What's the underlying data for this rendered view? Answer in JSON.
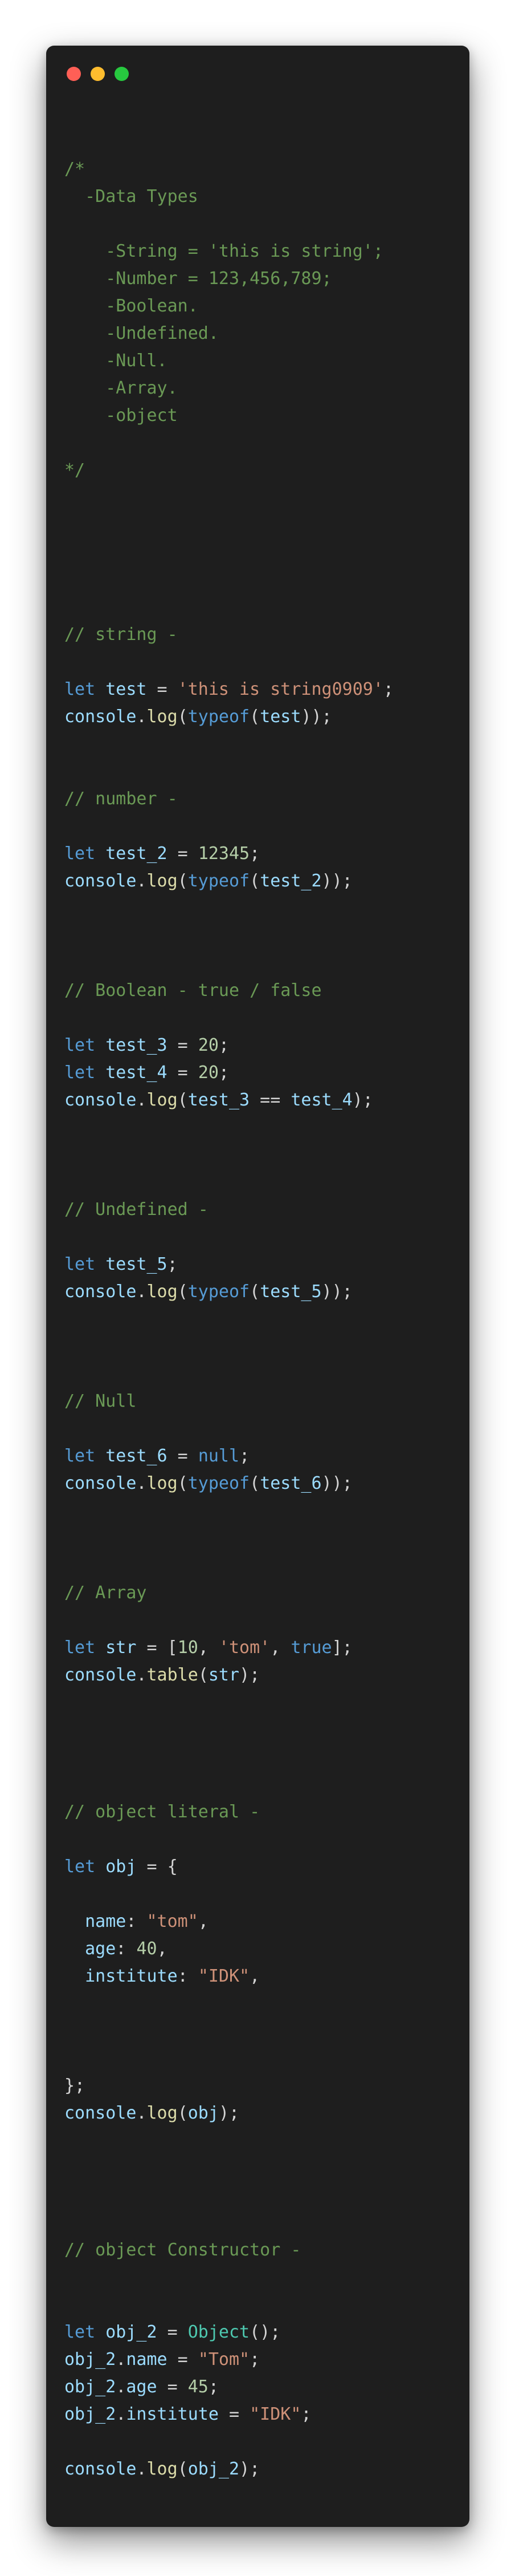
{
  "window": {
    "controls": [
      {
        "name": "close",
        "color": "#ff5f56"
      },
      {
        "name": "minimize",
        "color": "#ffbd2e"
      },
      {
        "name": "maximize",
        "color": "#27c93f"
      }
    ]
  },
  "colors": {
    "background": "#1e1e1e",
    "comment": "#6a9955",
    "keyword": "#569cd6",
    "variable": "#9cdcfe",
    "function": "#dcdcaa",
    "string": "#ce9178",
    "number": "#b5cea8",
    "class": "#4ec9b0",
    "plain": "#d4d4d4"
  },
  "code": {
    "lines": [
      [
        {
          "t": "comment",
          "v": "/*"
        }
      ],
      [
        {
          "t": "comment",
          "v": "  -Data Types"
        }
      ],
      [],
      [
        {
          "t": "comment",
          "v": "    -String = 'this is string';"
        }
      ],
      [
        {
          "t": "comment",
          "v": "    -Number = 123,456,789;"
        }
      ],
      [
        {
          "t": "comment",
          "v": "    -Boolean."
        }
      ],
      [
        {
          "t": "comment",
          "v": "    -Undefined."
        }
      ],
      [
        {
          "t": "comment",
          "v": "    -Null."
        }
      ],
      [
        {
          "t": "comment",
          "v": "    -Array."
        }
      ],
      [
        {
          "t": "comment",
          "v": "    -object"
        }
      ],
      [],
      [
        {
          "t": "comment",
          "v": "*/"
        }
      ],
      [],
      [],
      [],
      [],
      [],
      [
        {
          "t": "comment",
          "v": "// string -"
        }
      ],
      [],
      [
        {
          "t": "keyword",
          "v": "let"
        },
        {
          "t": "plain",
          "v": " "
        },
        {
          "t": "var",
          "v": "test"
        },
        {
          "t": "plain",
          "v": " = "
        },
        {
          "t": "string",
          "v": "'this is string0909'"
        },
        {
          "t": "plain",
          "v": ";"
        }
      ],
      [
        {
          "t": "var",
          "v": "console"
        },
        {
          "t": "plain",
          "v": "."
        },
        {
          "t": "fn",
          "v": "log"
        },
        {
          "t": "plain",
          "v": "("
        },
        {
          "t": "keyword",
          "v": "typeof"
        },
        {
          "t": "plain",
          "v": "("
        },
        {
          "t": "var",
          "v": "test"
        },
        {
          "t": "plain",
          "v": "));"
        }
      ],
      [],
      [],
      [
        {
          "t": "comment",
          "v": "// number -"
        }
      ],
      [],
      [
        {
          "t": "keyword",
          "v": "let"
        },
        {
          "t": "plain",
          "v": " "
        },
        {
          "t": "var",
          "v": "test_2"
        },
        {
          "t": "plain",
          "v": " = "
        },
        {
          "t": "number",
          "v": "12345"
        },
        {
          "t": "plain",
          "v": ";"
        }
      ],
      [
        {
          "t": "var",
          "v": "console"
        },
        {
          "t": "plain",
          "v": "."
        },
        {
          "t": "fn",
          "v": "log"
        },
        {
          "t": "plain",
          "v": "("
        },
        {
          "t": "keyword",
          "v": "typeof"
        },
        {
          "t": "plain",
          "v": "("
        },
        {
          "t": "var",
          "v": "test_2"
        },
        {
          "t": "plain",
          "v": "));"
        }
      ],
      [],
      [],
      [],
      [
        {
          "t": "comment",
          "v": "// Boolean - true / false"
        }
      ],
      [],
      [
        {
          "t": "keyword",
          "v": "let"
        },
        {
          "t": "plain",
          "v": " "
        },
        {
          "t": "var",
          "v": "test_3"
        },
        {
          "t": "plain",
          "v": " = "
        },
        {
          "t": "number",
          "v": "20"
        },
        {
          "t": "plain",
          "v": ";"
        }
      ],
      [
        {
          "t": "keyword",
          "v": "let"
        },
        {
          "t": "plain",
          "v": " "
        },
        {
          "t": "var",
          "v": "test_4"
        },
        {
          "t": "plain",
          "v": " = "
        },
        {
          "t": "number",
          "v": "20"
        },
        {
          "t": "plain",
          "v": ";"
        }
      ],
      [
        {
          "t": "var",
          "v": "console"
        },
        {
          "t": "plain",
          "v": "."
        },
        {
          "t": "fn",
          "v": "log"
        },
        {
          "t": "plain",
          "v": "("
        },
        {
          "t": "var",
          "v": "test_3"
        },
        {
          "t": "plain",
          "v": " == "
        },
        {
          "t": "var",
          "v": "test_4"
        },
        {
          "t": "plain",
          "v": ");"
        }
      ],
      [],
      [],
      [],
      [
        {
          "t": "comment",
          "v": "// Undefined -"
        }
      ],
      [],
      [
        {
          "t": "keyword",
          "v": "let"
        },
        {
          "t": "plain",
          "v": " "
        },
        {
          "t": "var",
          "v": "test_5"
        },
        {
          "t": "plain",
          "v": ";"
        }
      ],
      [
        {
          "t": "var",
          "v": "console"
        },
        {
          "t": "plain",
          "v": "."
        },
        {
          "t": "fn",
          "v": "log"
        },
        {
          "t": "plain",
          "v": "("
        },
        {
          "t": "keyword",
          "v": "typeof"
        },
        {
          "t": "plain",
          "v": "("
        },
        {
          "t": "var",
          "v": "test_5"
        },
        {
          "t": "plain",
          "v": "));"
        }
      ],
      [],
      [],
      [],
      [
        {
          "t": "comment",
          "v": "// Null"
        }
      ],
      [],
      [
        {
          "t": "keyword",
          "v": "let"
        },
        {
          "t": "plain",
          "v": " "
        },
        {
          "t": "var",
          "v": "test_6"
        },
        {
          "t": "plain",
          "v": " = "
        },
        {
          "t": "keyword",
          "v": "null"
        },
        {
          "t": "plain",
          "v": ";"
        }
      ],
      [
        {
          "t": "var",
          "v": "console"
        },
        {
          "t": "plain",
          "v": "."
        },
        {
          "t": "fn",
          "v": "log"
        },
        {
          "t": "plain",
          "v": "("
        },
        {
          "t": "keyword",
          "v": "typeof"
        },
        {
          "t": "plain",
          "v": "("
        },
        {
          "t": "var",
          "v": "test_6"
        },
        {
          "t": "plain",
          "v": "));"
        }
      ],
      [],
      [],
      [],
      [
        {
          "t": "comment",
          "v": "// Array"
        }
      ],
      [],
      [
        {
          "t": "keyword",
          "v": "let"
        },
        {
          "t": "plain",
          "v": " "
        },
        {
          "t": "var",
          "v": "str"
        },
        {
          "t": "plain",
          "v": " = ["
        },
        {
          "t": "number",
          "v": "10"
        },
        {
          "t": "plain",
          "v": ", "
        },
        {
          "t": "string",
          "v": "'tom'"
        },
        {
          "t": "plain",
          "v": ", "
        },
        {
          "t": "keyword",
          "v": "true"
        },
        {
          "t": "plain",
          "v": "];"
        }
      ],
      [
        {
          "t": "var",
          "v": "console"
        },
        {
          "t": "plain",
          "v": "."
        },
        {
          "t": "fn",
          "v": "table"
        },
        {
          "t": "plain",
          "v": "("
        },
        {
          "t": "var",
          "v": "str"
        },
        {
          "t": "plain",
          "v": ");"
        }
      ],
      [],
      [],
      [],
      [],
      [
        {
          "t": "comment",
          "v": "// object literal -"
        }
      ],
      [],
      [
        {
          "t": "keyword",
          "v": "let"
        },
        {
          "t": "plain",
          "v": " "
        },
        {
          "t": "var",
          "v": "obj"
        },
        {
          "t": "plain",
          "v": " = {"
        }
      ],
      [],
      [
        {
          "t": "plain",
          "v": "  "
        },
        {
          "t": "var",
          "v": "name"
        },
        {
          "t": "plain",
          "v": ": "
        },
        {
          "t": "string",
          "v": "\"tom\""
        },
        {
          "t": "plain",
          "v": ","
        }
      ],
      [
        {
          "t": "plain",
          "v": "  "
        },
        {
          "t": "var",
          "v": "age"
        },
        {
          "t": "plain",
          "v": ": "
        },
        {
          "t": "number",
          "v": "40"
        },
        {
          "t": "plain",
          "v": ","
        }
      ],
      [
        {
          "t": "plain",
          "v": "  "
        },
        {
          "t": "var",
          "v": "institute"
        },
        {
          "t": "plain",
          "v": ": "
        },
        {
          "t": "string",
          "v": "\"IDK\""
        },
        {
          "t": "plain",
          "v": ","
        }
      ],
      [],
      [],
      [],
      [
        {
          "t": "plain",
          "v": "};"
        }
      ],
      [
        {
          "t": "var",
          "v": "console"
        },
        {
          "t": "plain",
          "v": "."
        },
        {
          "t": "fn",
          "v": "log"
        },
        {
          "t": "plain",
          "v": "("
        },
        {
          "t": "var",
          "v": "obj"
        },
        {
          "t": "plain",
          "v": ");"
        }
      ],
      [],
      [],
      [],
      [],
      [
        {
          "t": "comment",
          "v": "// object Constructor -"
        }
      ],
      [],
      [],
      [
        {
          "t": "keyword",
          "v": "let"
        },
        {
          "t": "plain",
          "v": " "
        },
        {
          "t": "var",
          "v": "obj_2"
        },
        {
          "t": "plain",
          "v": " = "
        },
        {
          "t": "class",
          "v": "Object"
        },
        {
          "t": "plain",
          "v": "();"
        }
      ],
      [
        {
          "t": "var",
          "v": "obj_2"
        },
        {
          "t": "plain",
          "v": "."
        },
        {
          "t": "var",
          "v": "name"
        },
        {
          "t": "plain",
          "v": " = "
        },
        {
          "t": "string",
          "v": "\"Tom\""
        },
        {
          "t": "plain",
          "v": ";"
        }
      ],
      [
        {
          "t": "var",
          "v": "obj_2"
        },
        {
          "t": "plain",
          "v": "."
        },
        {
          "t": "var",
          "v": "age"
        },
        {
          "t": "plain",
          "v": " = "
        },
        {
          "t": "number",
          "v": "45"
        },
        {
          "t": "plain",
          "v": ";"
        }
      ],
      [
        {
          "t": "var",
          "v": "obj_2"
        },
        {
          "t": "plain",
          "v": "."
        },
        {
          "t": "var",
          "v": "institute"
        },
        {
          "t": "plain",
          "v": " = "
        },
        {
          "t": "string",
          "v": "\"IDK\""
        },
        {
          "t": "plain",
          "v": ";"
        }
      ],
      [],
      [
        {
          "t": "var",
          "v": "console"
        },
        {
          "t": "plain",
          "v": "."
        },
        {
          "t": "fn",
          "v": "log"
        },
        {
          "t": "plain",
          "v": "("
        },
        {
          "t": "var",
          "v": "obj_2"
        },
        {
          "t": "plain",
          "v": ");"
        }
      ]
    ]
  }
}
